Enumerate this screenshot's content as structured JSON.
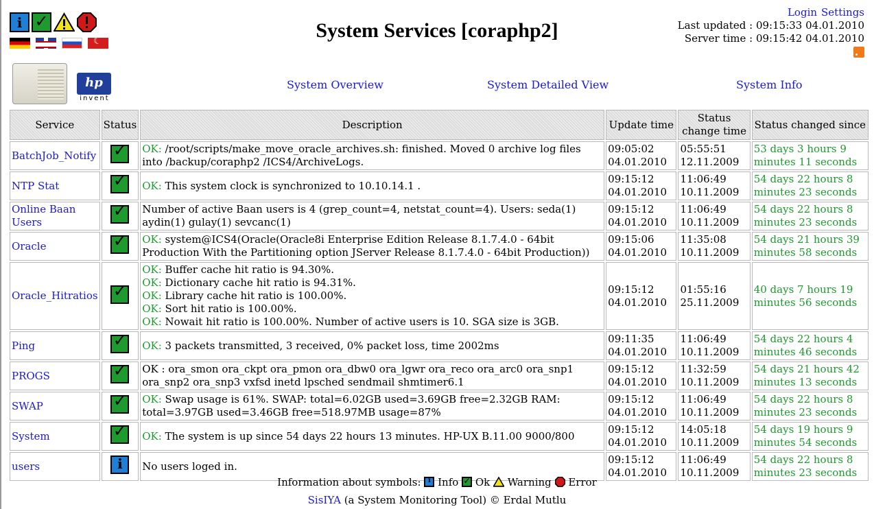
{
  "header": {
    "title": "System Services [coraphp2]",
    "login_label": "Login",
    "settings_label": "Settings",
    "last_updated": "Last updated : 09:15:33 04.01.2010",
    "server_time": "Server time : 09:15:42 04.01.2010",
    "hp_logo_text": "hp",
    "hp_tagline": "invent"
  },
  "nav": {
    "overview": "System Overview",
    "detailed": "System Detailed View",
    "info": "System Info"
  },
  "table": {
    "columns": [
      "Service",
      "Status",
      "Description",
      "Update time",
      "Status change time",
      "Status changed since"
    ],
    "rows": [
      {
        "service": "BatchJob_Notify",
        "status": "ok",
        "ok_prefix": "OK:",
        "description": "/root/scripts/make_move_oracle_archives.sh: finished. Moved 0 archive log files into /backup/coraphp2 /ICS4/ArchiveLogs.",
        "update_time": "09:05:02",
        "update_date": "04.01.2010",
        "change_time": "05:55:51",
        "change_date": "12.11.2009",
        "since": "53 days 3 hours 9 minutes 11 seconds"
      },
      {
        "service": "NTP Stat",
        "status": "ok",
        "ok_prefix": "OK:",
        "description": "This system clock is synchronized to 10.10.14.1 .",
        "update_time": "09:15:12",
        "update_date": "04.01.2010",
        "change_time": "11:06:49",
        "change_date": "10.11.2009",
        "since": "54 days 22 hours 8 minutes 23 seconds"
      },
      {
        "service": "Online Baan Users",
        "status": "ok",
        "ok_prefix": "",
        "description": "Number of active Baan users is 4 (grep_count=4, netstat_count=4). Users: seda(1) aydin(1) gulay(1) sevcanc(1)",
        "update_time": "09:15:12",
        "update_date": "04.01.2010",
        "change_time": "11:06:49",
        "change_date": "10.11.2009",
        "since": "54 days 22 hours 8 minutes 23 seconds"
      },
      {
        "service": "Oracle",
        "status": "ok",
        "ok_prefix": "OK:",
        "description": "system@ICS4(Oracle(Oracle8i Enterprise Edition Release 8.1.7.4.0 - 64bit Production With the Partitioning option JServer Release 8.1.7.4.0 - 64bit Production))",
        "update_time": "09:15:06",
        "update_date": "04.01.2010",
        "change_time": "11:35:08",
        "change_date": "10.11.2009",
        "since": "54 days 21 hours 39 minutes 58 seconds"
      },
      {
        "service": "Oracle_Hitratios",
        "status": "ok",
        "lines": [
          {
            "prefix": "OK:",
            "text": "Buffer cache hit ratio is 94.30%."
          },
          {
            "prefix": "OK:",
            "text": "Dictionary cache hit ratio is 94.31%."
          },
          {
            "prefix": "OK:",
            "text": "Library cache hit ratio is 100.00%."
          },
          {
            "prefix": "OK:",
            "text": "Sort hit ratio is 100.00%."
          },
          {
            "prefix": "OK:",
            "text": "Nowait hit ratio is 100.00%. Number of active users is 10. SGA size is 3GB."
          }
        ],
        "update_time": "09:15:12",
        "update_date": "04.01.2010",
        "change_time": "01:55:16",
        "change_date": "25.11.2009",
        "since": "40 days 7 hours 19 minutes 56 seconds"
      },
      {
        "service": "Ping",
        "status": "ok",
        "ok_prefix": "OK:",
        "description": "3 packets transmitted, 3 received, 0% packet loss, time 2002ms",
        "update_time": "09:11:35",
        "update_date": "04.01.2010",
        "change_time": "11:06:49",
        "change_date": "10.11.2009",
        "since": "54 days 22 hours 4 minutes 46 seconds"
      },
      {
        "service": "PROGS",
        "status": "ok",
        "ok_prefix": "",
        "description": "OK : ora_smon ora_ckpt ora_pmon ora_dbw0 ora_lgwr ora_reco ora_arc0 ora_snp1 ora_snp2 ora_snp3 vxfsd inetd lpsched sendmail shmtimer6.1",
        "update_time": "09:15:12",
        "update_date": "04.01.2010",
        "change_time": "11:32:59",
        "change_date": "10.11.2009",
        "since": "54 days 21 hours 42 minutes 13 seconds"
      },
      {
        "service": "SWAP",
        "status": "ok",
        "ok_prefix": "OK:",
        "description": "Swap usage is 61%. SWAP: total=6.02GB used=3.69GB free=2.32GB RAM: total=3.97GB used=3.46GB free=518.97MB usage=87%",
        "update_time": "09:15:12",
        "update_date": "04.01.2010",
        "change_time": "11:06:49",
        "change_date": "10.11.2009",
        "since": "54 days 22 hours 8 minutes 23 seconds"
      },
      {
        "service": "System",
        "status": "ok",
        "ok_prefix": "OK:",
        "description": "The system is up since 54 days 22 hours 13 minutes. HP-UX B.11.00 9000/800",
        "update_time": "09:15:12",
        "update_date": "04.01.2010",
        "change_time": "14:05:18",
        "change_date": "10.11.2009",
        "since": "54 days 19 hours 9 minutes 54 seconds"
      },
      {
        "service": "users",
        "status": "info",
        "ok_prefix": "",
        "description": "No users loged in.",
        "update_time": "09:15:12",
        "update_date": "04.01.2010",
        "change_time": "11:06:49",
        "change_date": "10.11.2009",
        "since": "54 days 22 hours 8 minutes 23 seconds"
      }
    ]
  },
  "legend": {
    "intro": "Information about symbols:",
    "info": "Info",
    "ok": "Ok",
    "warning": "Warning",
    "error": "Error"
  },
  "footer": {
    "link": "SisIYA",
    "text": "(a System Monitoring Tool) © Erdal Mutlu"
  },
  "colors": {
    "ok_text": "#1e9a2e",
    "link": "#1a1ad6",
    "header_bg": "#dcdcdc",
    "info_icon": "#1f7fd6",
    "ok_icon": "#1e9a2e",
    "warning_icon": "#f2e21a",
    "error_icon": "#d01818"
  },
  "icons": [
    "info-icon",
    "ok-icon",
    "warning-icon",
    "error-icon",
    "flag-german-icon",
    "flag-uk-icon",
    "flag-russian-icon",
    "flag-turkish-icon",
    "rss-icon",
    "server-icon",
    "hp-logo-icon"
  ]
}
